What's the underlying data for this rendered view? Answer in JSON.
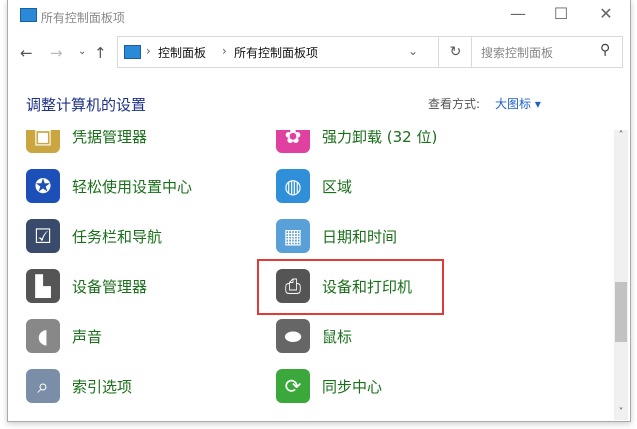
{
  "window": {
    "title": "所有控制面板项",
    "minimize": "—",
    "maximize": "☐",
    "close": "✕"
  },
  "nav": {
    "back": "←",
    "forward": "→",
    "recent": "⌄",
    "up": "↑",
    "refresh": "↻",
    "dropdown": "⌄"
  },
  "address": {
    "sep": "›",
    "crumbs": [
      "控制面板",
      "所有控制面板项"
    ]
  },
  "search": {
    "placeholder": "搜索控制面板",
    "icon": "⚲"
  },
  "header": {
    "title": "调整计算机的设置",
    "view_label": "查看方式:",
    "view_value": "大图标",
    "view_arrow": "▾"
  },
  "items": [
    {
      "label": "凭据管理器",
      "icon": "credential-manager",
      "color": "#c9a640",
      "glyph": "▣"
    },
    {
      "label": "强力卸载 (32 位)",
      "icon": "uninstaller",
      "color": "#e040a0",
      "glyph": "✿"
    },
    {
      "label": "轻松使用设置中心",
      "icon": "ease-of-access",
      "color": "#1d4fb8",
      "glyph": "✪"
    },
    {
      "label": "区域",
      "icon": "region-globe",
      "color": "#2f8fd8",
      "glyph": "◍"
    },
    {
      "label": "任务栏和导航",
      "icon": "taskbar",
      "color": "#3a4a6a",
      "glyph": "☑"
    },
    {
      "label": "日期和时间",
      "icon": "date-time",
      "color": "#5aa0d8",
      "glyph": "▦"
    },
    {
      "label": "设备管理器",
      "icon": "device-manager",
      "color": "#555",
      "glyph": "▙"
    },
    {
      "label": "设备和打印机",
      "icon": "devices-printers",
      "color": "#555",
      "glyph": "⎙"
    },
    {
      "label": "声音",
      "icon": "speaker",
      "color": "#888",
      "glyph": "◖"
    },
    {
      "label": "鼠标",
      "icon": "mouse",
      "color": "#666",
      "glyph": "⬬"
    },
    {
      "label": "索引选项",
      "icon": "indexing-magnifier",
      "color": "#7a8ea8",
      "glyph": "⌕"
    },
    {
      "label": "同步中心",
      "icon": "sync-center",
      "color": "#3aa83a",
      "glyph": "⟳"
    }
  ],
  "scroll": {
    "up": "˄",
    "down": "˅",
    "position_fraction": 0.6
  }
}
